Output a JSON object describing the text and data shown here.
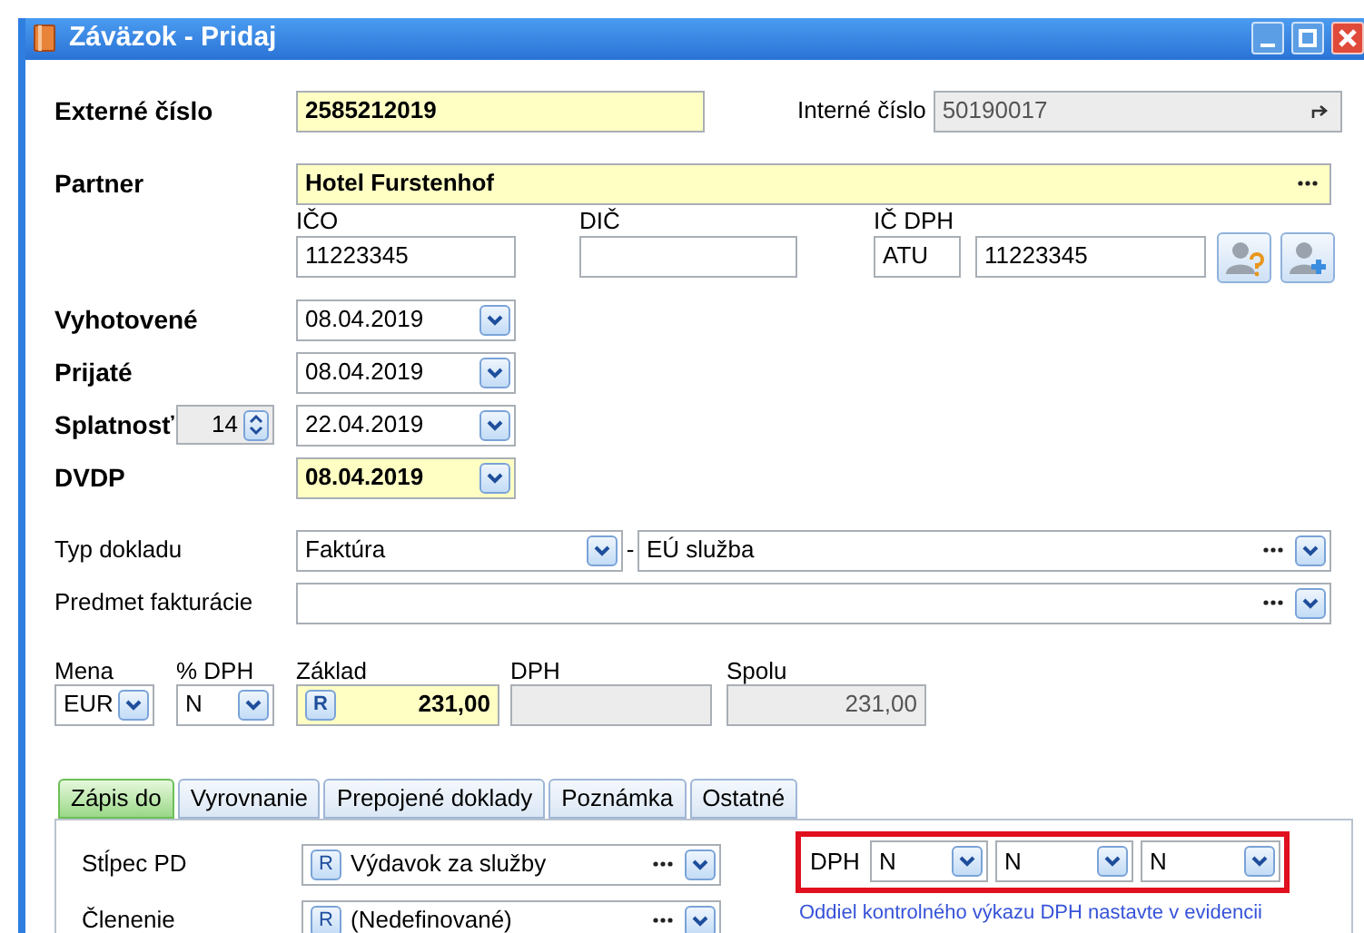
{
  "window": {
    "title": "Záväzok - Pridaj"
  },
  "external_number": {
    "label": "Externé číslo",
    "value": "2585212019",
    "highlighted": true
  },
  "internal_number": {
    "label": "Interné číslo",
    "value": "50190017"
  },
  "partner": {
    "label": "Partner",
    "value": "Hotel Furstenhof",
    "highlighted": true
  },
  "ico": {
    "label": "IČO",
    "value": "11223345"
  },
  "dic": {
    "label": "DIČ"
  },
  "ic_dph": {
    "label": "IČ DPH",
    "prefix": "ATU",
    "value": "11223345"
  },
  "dates": [
    {
      "label": "Vyhotovené",
      "value": "08.04.2019",
      "highlighted": false
    },
    {
      "label": "Prijaté",
      "value": "08.04.2019",
      "highlighted": false
    },
    {
      "label": "Splatnosť",
      "days": "14",
      "value": "22.04.2019",
      "highlighted": false
    },
    {
      "label": "DVDP",
      "value": "08.04.2019",
      "highlighted": true
    }
  ],
  "document_type": {
    "label": "Typ dokladu",
    "value": "Faktúra",
    "separator": "-",
    "subtype": "EÚ služba"
  },
  "subject": {
    "label": "Predmet fakturácie"
  },
  "amounts": [
    {
      "label": "Mena",
      "value": "EUR",
      "kind": "combo"
    },
    {
      "label": "% DPH",
      "value": "N",
      "kind": "combo"
    },
    {
      "label": "Základ",
      "value": "231,00",
      "kind": "input",
      "button": "R",
      "highlighted": true
    },
    {
      "label": "DPH",
      "kind": "readonly"
    },
    {
      "label": "Spolu",
      "value": "231,00",
      "kind": "readonly"
    }
  ],
  "tabs": [
    {
      "label": "Zápis do",
      "selected": true
    },
    {
      "label": "Vyrovnanie",
      "selected": false
    },
    {
      "label": "Prepojené doklady",
      "selected": false
    },
    {
      "label": "Poznámka",
      "selected": false
    },
    {
      "label": "Ostatné",
      "selected": false
    }
  ],
  "posting": [
    {
      "label": "Stĺpec PD",
      "button": "R",
      "value": "Výdavok za služby"
    },
    {
      "label": "Členenie",
      "button": "R",
      "value": "(Nedefinované)"
    }
  ],
  "vat": {
    "label": "DPH",
    "options": [
      "N",
      "N",
      "N"
    ],
    "note": "Oddiel kontrolného výkazu DPH nastavte v evidencii"
  }
}
